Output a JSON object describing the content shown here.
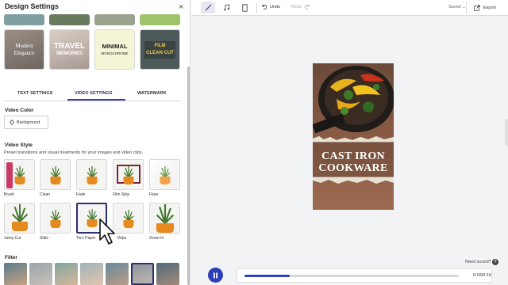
{
  "panel": {
    "title": "Design Settings",
    "templates": [
      {
        "name": "modern-elegance",
        "line1": "Modern",
        "line2": "Elegance"
      },
      {
        "name": "travel-memories",
        "line1": "TRAVEL",
        "line2": "MEMORIES"
      },
      {
        "name": "minimal-monochrome",
        "line1": "MINIMAL",
        "line2": "MONOCHROME"
      },
      {
        "name": "film-clean-cut",
        "line1": "FILM",
        "line2": "CLEAN CUT"
      }
    ],
    "tabs": [
      "TEXT SETTINGS",
      "VIDEO SETTINGS",
      "WATERMARK"
    ],
    "active_tab": "VIDEO SETTINGS",
    "video_color": {
      "heading": "Video Color",
      "button": "Background"
    },
    "video_style": {
      "heading": "Video Style",
      "description": "Preset transitions and visual treatments for your images and video clips.",
      "styles": [
        "Brush",
        "Clean",
        "Fade",
        "Film Strip",
        "Flare",
        "Jump Cut",
        "Slide",
        "Torn Paper",
        "Wipe",
        "Zoom In"
      ],
      "selected": "Torn Paper"
    },
    "filter": {
      "heading": "Filter"
    }
  },
  "toolbar": {
    "undo": "Undo",
    "redo": "Redo",
    "saved": "Saved",
    "export": "Export"
  },
  "canvas": {
    "headline_line1": "CAST IRON",
    "headline_line2": "COOKWARE"
  },
  "playback": {
    "need_sound": "Need sound?",
    "help": "?",
    "time": "0:03/0:16",
    "progress": 0.21
  },
  "colors": {
    "accent": "#2d40b8",
    "tab_underline": "#3b3bb7",
    "selected_border": "#2b2f6e"
  }
}
